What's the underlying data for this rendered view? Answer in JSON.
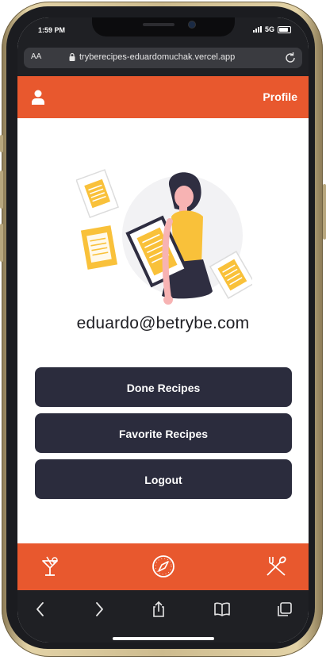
{
  "status_bar": {
    "time": "1:59 PM",
    "network": "5G"
  },
  "browser": {
    "text_size_label": "AA",
    "url": "tryberecipes-eduardomuchak.vercel.app"
  },
  "header": {
    "title": "Profile",
    "profile_icon": "profile-icon"
  },
  "profile": {
    "email": "eduardo@betrybe.com"
  },
  "buttons": {
    "done_recipes": "Done Recipes",
    "favorite_recipes": "Favorite Recipes",
    "logout": "Logout"
  },
  "footer": {
    "icons": [
      "drink-icon",
      "explore-icon",
      "food-icon"
    ]
  },
  "toolbar": {
    "icons": [
      "back-icon",
      "forward-icon",
      "share-icon",
      "bookmarks-icon",
      "tabs-icon"
    ]
  },
  "colors": {
    "accent": "#e8582e",
    "button": "#2b2c3d",
    "illustration_yellow": "#f9c13a"
  }
}
